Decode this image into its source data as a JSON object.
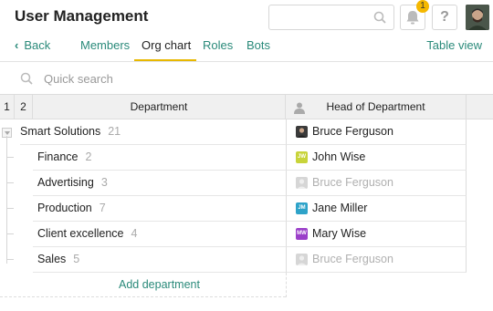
{
  "header": {
    "title": "User Management",
    "search_placeholder": "",
    "notification_count": "1",
    "help_label": "?"
  },
  "nav": {
    "back_label": "Back",
    "tabs": [
      {
        "label": "Members"
      },
      {
        "label": "Org chart"
      },
      {
        "label": "Roles"
      },
      {
        "label": "Bots"
      }
    ],
    "active_tab": "Org chart",
    "table_view_label": "Table view"
  },
  "quick_search": {
    "placeholder": "Quick search"
  },
  "grid": {
    "col_1": "1",
    "col_2": "2",
    "col_department": "Department",
    "col_head": "Head of Department",
    "rows": [
      {
        "department": "Smart Solutions",
        "count": "21",
        "head": "Bruce Ferguson",
        "avatar_initials": "",
        "avatar_color": "#3a3a3a",
        "vacant": false
      },
      {
        "department": "Finance",
        "count": "2",
        "head": "John Wise",
        "avatar_initials": "JW",
        "avatar_color": "#c8d43a",
        "vacant": false
      },
      {
        "department": "Advertising",
        "count": "3",
        "head": "Bruce Ferguson",
        "avatar_initials": "",
        "avatar_color": "#cfcfcf",
        "vacant": true
      },
      {
        "department": "Production",
        "count": "7",
        "head": "Jane Miller",
        "avatar_initials": "JM",
        "avatar_color": "#2ea3c9",
        "vacant": false
      },
      {
        "department": "Client excellence",
        "count": "4",
        "head": "Mary Wise",
        "avatar_initials": "MW",
        "avatar_color": "#9b3fc9",
        "vacant": false
      },
      {
        "department": "Sales",
        "count": "5",
        "head": "Bruce Ferguson",
        "avatar_initials": "",
        "avatar_color": "#cfcfcf",
        "vacant": true
      }
    ],
    "add_label": "Add department"
  },
  "colors": {
    "accent": "#2a8a7a",
    "tab_underline": "#e8b800",
    "badge": "#f5b800"
  }
}
